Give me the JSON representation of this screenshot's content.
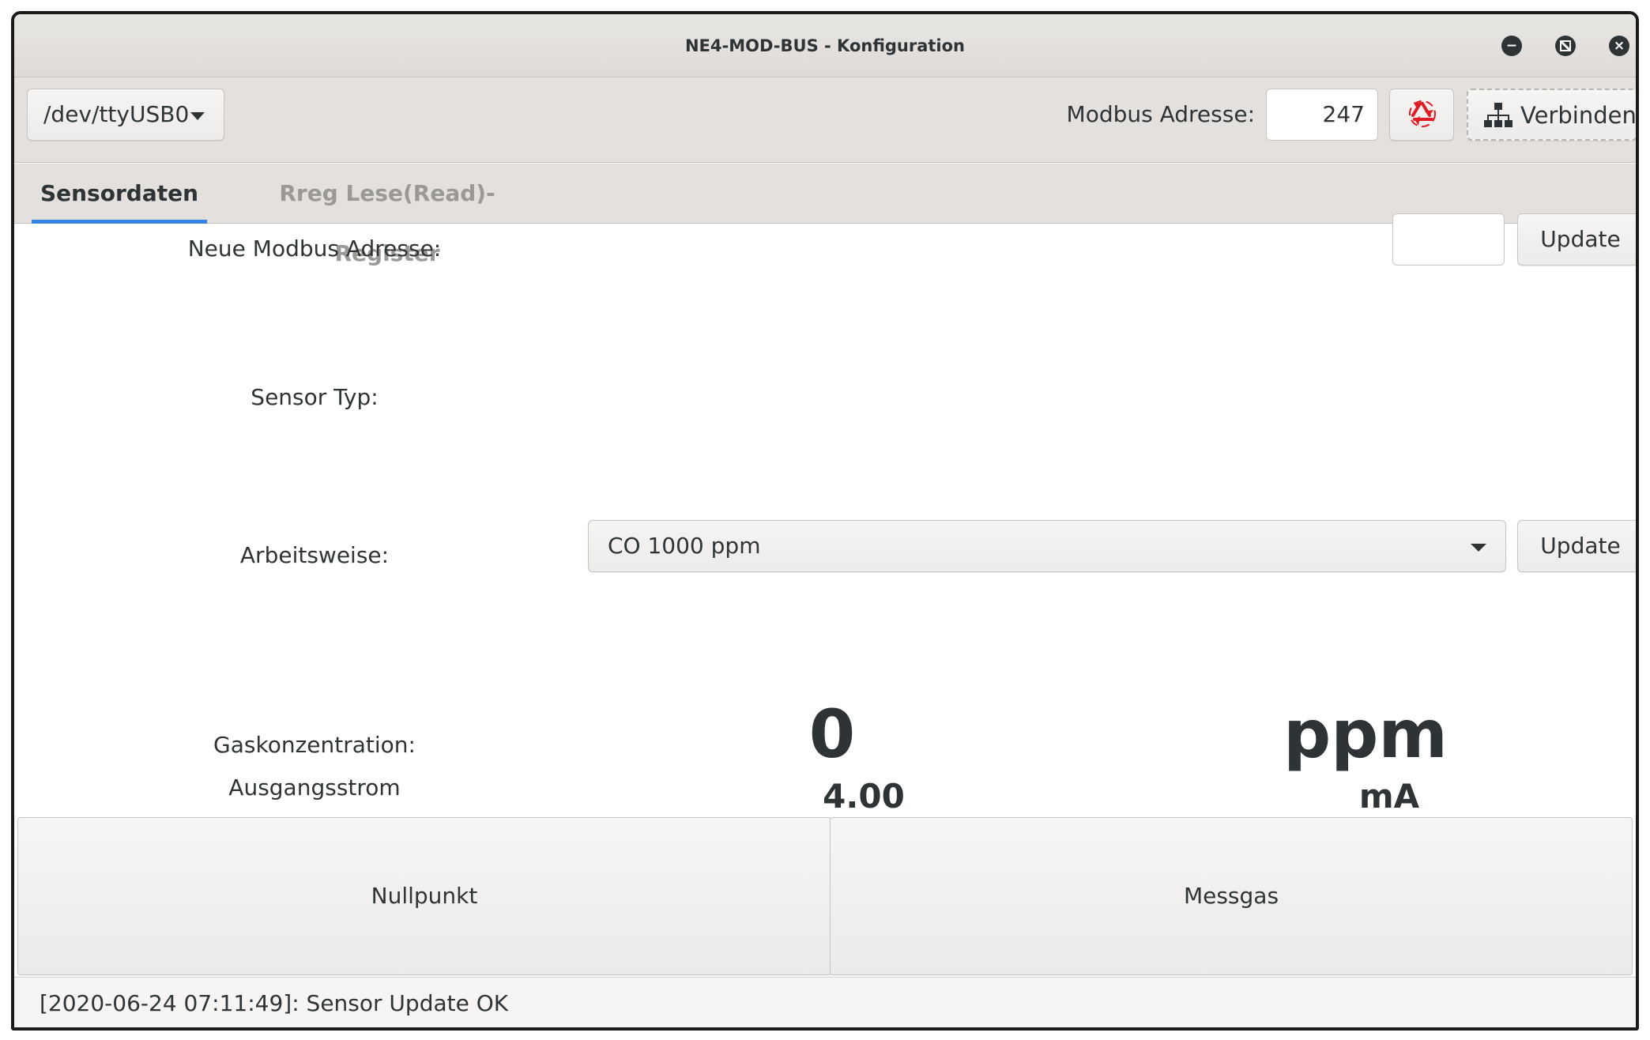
{
  "window": {
    "title": "NE4-MOD-BUS - Konfiguration",
    "controls": {
      "minimize_icon": "minimize-icon",
      "maximize_icon": "maximize-icon",
      "close_icon": "close-icon"
    }
  },
  "toolbar": {
    "port_value": "/dev/ttyUSB0",
    "modbus_label": "Modbus Adresse:",
    "modbus_value": "247",
    "refresh_icon": "recycle-icon",
    "connect_label": "Verbinden",
    "connect_icon": "network-icon"
  },
  "tabs": [
    {
      "label": "Sensordaten",
      "active": true
    },
    {
      "label": "Rreg Lese(Read)-Register",
      "active": false
    }
  ],
  "sensor": {
    "new_address_label": "Neue Modbus Adresse:",
    "new_address_value": "",
    "update_label": "Update",
    "sensor_type_label": "Sensor Typ:",
    "mode_label": "Arbeitsweise:",
    "mode_value": "CO 1000 ppm",
    "gas_label": "Gaskonzentration:",
    "gas_value": "0",
    "gas_unit": "ppm",
    "current_label": "Ausgangsstrom",
    "current_value": "4.00",
    "current_unit": "mA"
  },
  "actions": {
    "zero_label": "Nullpunkt",
    "span_label": "Messgas"
  },
  "status": {
    "text": "[2020-06-24 07:11:49]: Sensor Update OK"
  },
  "colors": {
    "accent": "#3584e4",
    "refresh_icon": "#e01b24",
    "text": "#2e3436",
    "muted_tab": "#9a9996"
  }
}
